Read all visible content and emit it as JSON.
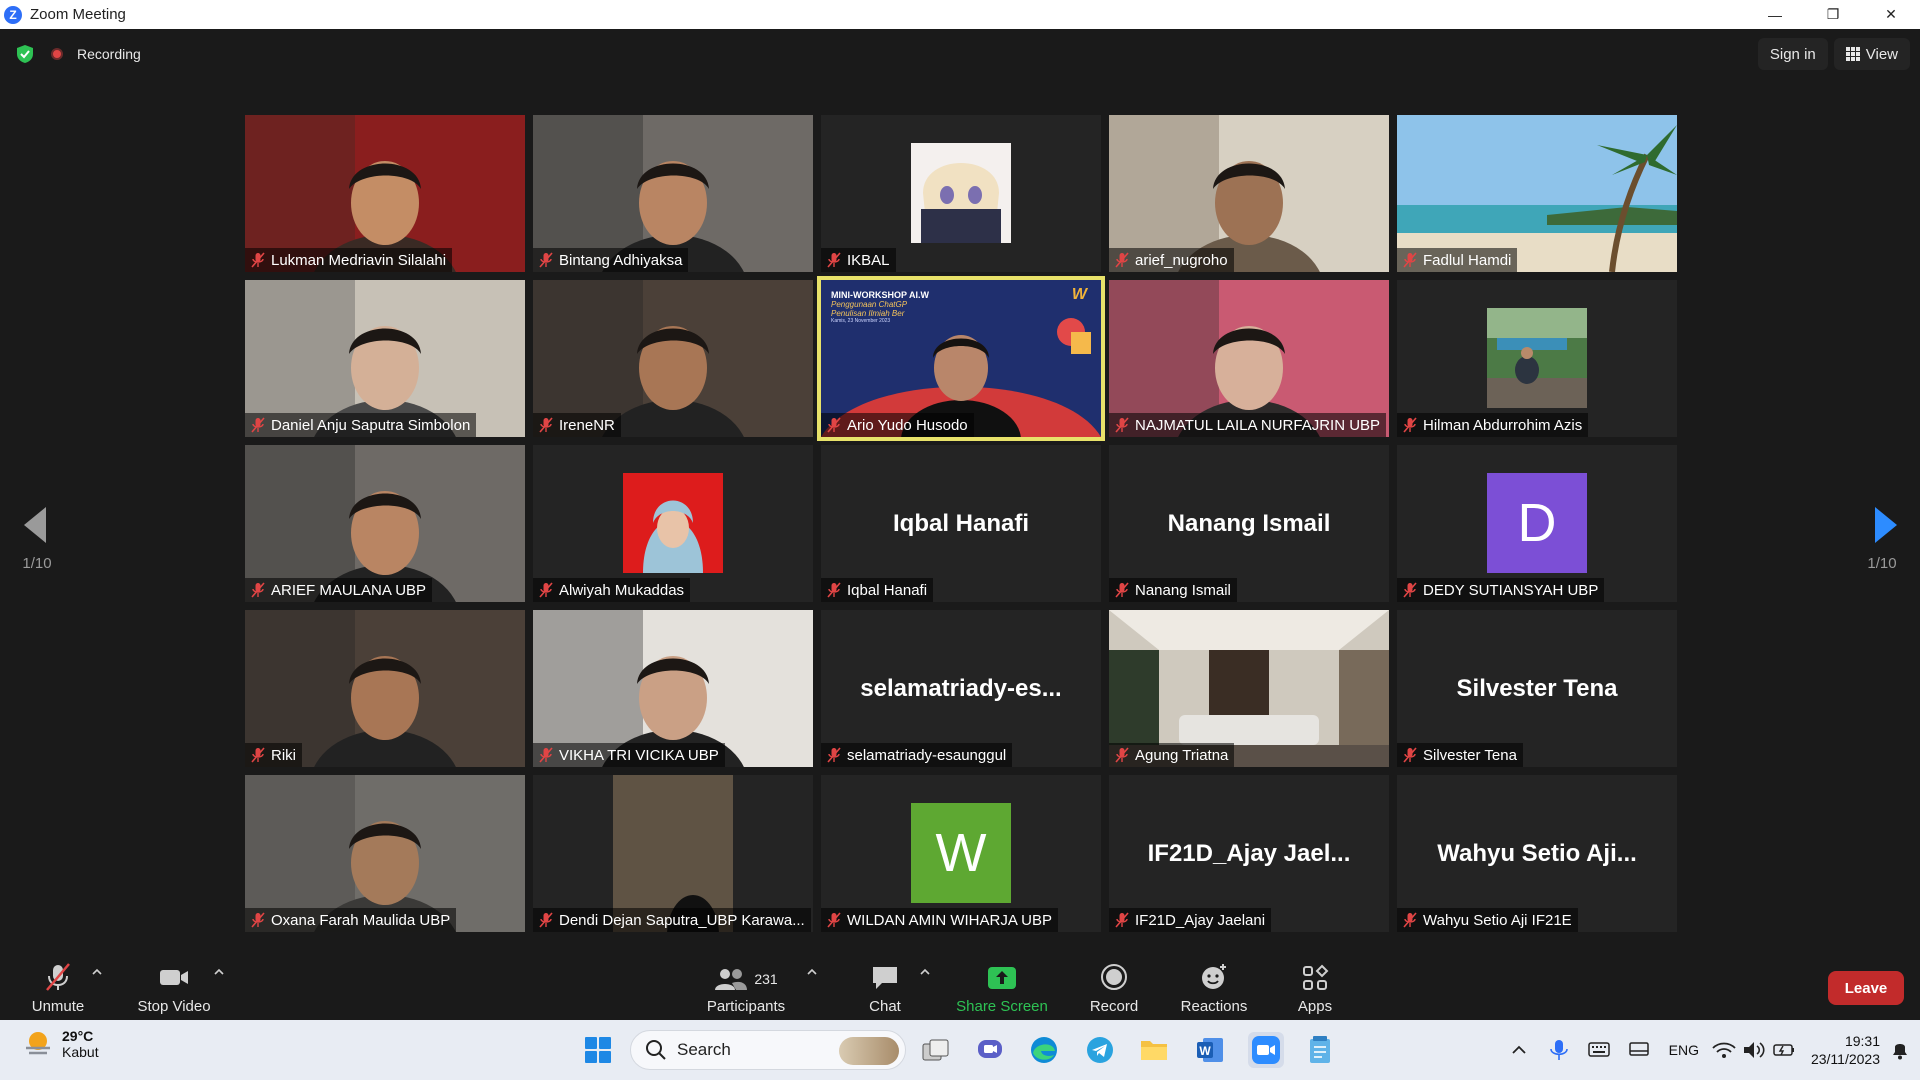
{
  "window": {
    "title": "Zoom Meeting",
    "minimize": "—",
    "maximize": "❐",
    "close": "✕"
  },
  "topbar": {
    "recording_label": "Recording",
    "sign_in": "Sign in",
    "view": "View"
  },
  "gallery": {
    "page_left": "1/10",
    "page_right": "1/10",
    "tiles": [
      {
        "name": "Lukman Medriavin Silalahi",
        "type": "video",
        "avatar": "person"
      },
      {
        "name": "Bintang Adhiyaksa",
        "type": "video",
        "avatar": "person"
      },
      {
        "name": "IKBAL",
        "type": "image",
        "avatar": "anime"
      },
      {
        "name": "arief_nugroho",
        "type": "video",
        "avatar": "person"
      },
      {
        "name": "Fadlul Hamdi",
        "type": "image",
        "avatar": "beach"
      },
      {
        "name": "Daniel Anju Saputra Simbolon",
        "type": "video",
        "avatar": "person"
      },
      {
        "name": "IreneNR",
        "type": "video",
        "avatar": "person"
      },
      {
        "name": "Ario Yudo Husodo",
        "type": "video",
        "avatar": "presenter",
        "active": true,
        "banner_title": "MINI-WORKSHOP AI.W",
        "banner_sub1": "Penggunaan ChatGP",
        "banner_sub2": "Penulisan Ilmiah Ber",
        "banner_date": "Kamis, 23 November 2023"
      },
      {
        "name": "NAJMATUL LAILA NURFAJRIN UBP",
        "type": "video",
        "avatar": "person"
      },
      {
        "name": "Hilman Abdurrohim Azis",
        "type": "image",
        "avatar": "outdoor"
      },
      {
        "name": "ARIEF MAULANA UBP",
        "type": "image",
        "avatar": "person"
      },
      {
        "name": "Alwiyah Mukaddas",
        "type": "image",
        "avatar": "hijab"
      },
      {
        "name": "Iqbal Hanafi",
        "type": "text",
        "display": "Iqbal Hanafi"
      },
      {
        "name": "Nanang Ismail",
        "type": "text",
        "display": "Nanang Ismail"
      },
      {
        "name": "DEDY SUTIANSYAH UBP",
        "type": "letter",
        "letter": "D",
        "color": "#7c4fd6"
      },
      {
        "name": "Riki",
        "type": "image",
        "avatar": "person"
      },
      {
        "name": "VIKHA TRI VICIKA UBP",
        "type": "video",
        "avatar": "person"
      },
      {
        "name": "selamatriady-esaunggul",
        "type": "text",
        "display": "selamatriady-es..."
      },
      {
        "name": "Agung Triatna",
        "type": "image",
        "avatar": "room"
      },
      {
        "name": "Silvester Tena",
        "type": "text",
        "display": "Silvester Tena"
      },
      {
        "name": "Oxana Farah Maulida UBP",
        "type": "video",
        "avatar": "person"
      },
      {
        "name": "Dendi Dejan Saputra_UBP Karawa...",
        "type": "video",
        "avatar": "dark"
      },
      {
        "name": "WILDAN AMIN WIHARJA UBP",
        "type": "letter",
        "letter": "W",
        "color": "#5ea832"
      },
      {
        "name": "IF21D_Ajay Jaelani",
        "type": "text",
        "display": "IF21D_Ajay  Jael..."
      },
      {
        "name": "Wahyu Setio Aji IF21E",
        "type": "text",
        "display": "Wahyu  Setio  Aji..."
      }
    ]
  },
  "toolbar": {
    "unmute": "Unmute",
    "stop_video": "Stop Video",
    "participants": "Participants",
    "participant_count": "231",
    "chat": "Chat",
    "share_screen": "Share Screen",
    "record": "Record",
    "reactions": "Reactions",
    "apps": "Apps",
    "leave": "Leave"
  },
  "taskbar": {
    "temperature": "29°C",
    "condition": "Kabut",
    "search": "Search",
    "language": "ENG",
    "time": "19:31",
    "date": "23/11/2023"
  },
  "colors": {
    "accent_blue": "#2d8cff",
    "share_green": "#2ec254",
    "leave_red": "#c22b2b",
    "active_speaker": "#e8e26a"
  }
}
